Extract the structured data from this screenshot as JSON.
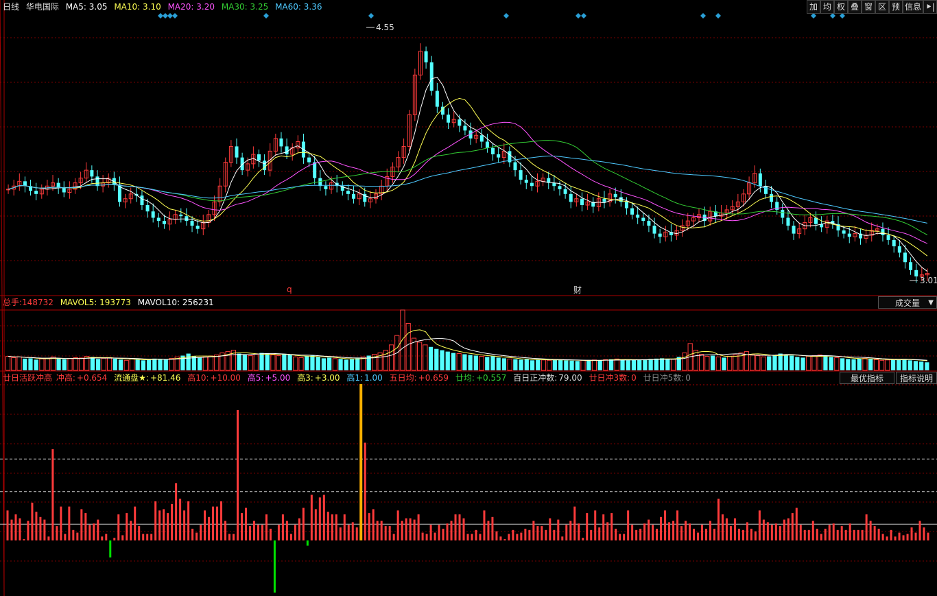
{
  "colors": {
    "up": "#ff3b3b",
    "down": "#54ffff",
    "ma5": "#ffffff",
    "ma10": "#ffff54",
    "ma20": "#ff54ff",
    "ma30": "#33cc33",
    "ma60": "#4ec9ff",
    "grid": "#7a0000",
    "marker": "#2a9fd6",
    "pos_bar": "#ff3b3b",
    "neg_bar": "#00e000",
    "highlight_bar": "#ffb000"
  },
  "header": {
    "period": "日线",
    "name": "华电国际",
    "ma5": {
      "label": "MA5:",
      "value": "3.05"
    },
    "ma10": {
      "label": "MA10:",
      "value": "3.10"
    },
    "ma20": {
      "label": "MA20:",
      "value": "3.20"
    },
    "ma30": {
      "label": "MA30:",
      "value": "3.25"
    },
    "ma60": {
      "label": "MA60:",
      "value": "3.36"
    }
  },
  "toolbar": [
    "加",
    "均",
    "权",
    "叠",
    "窗",
    "区",
    "预",
    "信息",
    "⯈|"
  ],
  "price_annotations": {
    "high": "4.55",
    "low": "3.01",
    "event_q": "q",
    "event_cai": "财"
  },
  "volume_header": {
    "total_label": "总手:",
    "total": "148732",
    "mavol5_label": "MAVOL5:",
    "mavol5": "193773",
    "mavol10_label": "MAVOL10:",
    "mavol10": "256231",
    "dropdown": "成交量"
  },
  "indicator_header": {
    "name": "廿日活跃冲高",
    "c1_label": "冲高:",
    "c1": "+0.654",
    "c2_label": "流通盘★:",
    "c2": "+81.46",
    "c3_label": "高10:",
    "c3": "+10.00",
    "c4_label": "高5:",
    "c4": "+5.00",
    "c5_label": "高3:",
    "c5": "+3.00",
    "c6_label": "高1:",
    "c6": "1.00",
    "c7_label": "五日均:",
    "c7": "+0.659",
    "c8_label": "廿均:",
    "c8": "+0.557",
    "c9_label": "百日正冲数:",
    "c9": "79.00",
    "c10_label": "廿日冲3数:",
    "c10": "0",
    "c11_label": "廿日冲5数:",
    "c11": "0",
    "btn_best": "最优指标",
    "btn_help": "指标说明"
  },
  "chart_data": [
    {
      "type": "candlestick",
      "title": "华电国际 日线",
      "ylim": [
        3.0,
        4.6
      ],
      "high_label": 4.55,
      "low_label": 3.01,
      "ma_latest": {
        "MA5": 3.05,
        "MA10": 3.1,
        "MA20": 3.2,
        "MA30": 3.25,
        "MA60": 3.36
      },
      "close": [
        3.58,
        3.6,
        3.63,
        3.6,
        3.57,
        3.55,
        3.58,
        3.6,
        3.62,
        3.59,
        3.56,
        3.58,
        3.62,
        3.65,
        3.7,
        3.66,
        3.6,
        3.62,
        3.65,
        3.61,
        3.5,
        3.52,
        3.55,
        3.54,
        3.48,
        3.44,
        3.4,
        3.38,
        3.36,
        3.39,
        3.42,
        3.41,
        3.38,
        3.35,
        3.33,
        3.37,
        3.42,
        3.5,
        3.6,
        3.75,
        3.85,
        3.78,
        3.7,
        3.74,
        3.8,
        3.76,
        3.7,
        3.82,
        3.9,
        3.85,
        3.8,
        3.84,
        3.88,
        3.78,
        3.75,
        3.65,
        3.6,
        3.58,
        3.62,
        3.6,
        3.57,
        3.55,
        3.52,
        3.55,
        3.5,
        3.52,
        3.55,
        3.6,
        3.66,
        3.72,
        3.78,
        3.85,
        4.05,
        4.3,
        4.45,
        4.38,
        4.2,
        4.1,
        4.05,
        4.0,
        4.02,
        3.98,
        3.95,
        3.9,
        3.92,
        3.88,
        3.84,
        3.8,
        3.78,
        3.82,
        3.75,
        3.7,
        3.64,
        3.62,
        3.6,
        3.63,
        3.65,
        3.62,
        3.6,
        3.58,
        3.55,
        3.5,
        3.52,
        3.48,
        3.5,
        3.47,
        3.52,
        3.5,
        3.55,
        3.53,
        3.5,
        3.46,
        3.42,
        3.4,
        3.38,
        3.35,
        3.3,
        3.28,
        3.31,
        3.29,
        3.32,
        3.35,
        3.38,
        3.4,
        3.42,
        3.38,
        3.44,
        3.41,
        3.43,
        3.45,
        3.47,
        3.5,
        3.55,
        3.62,
        3.68,
        3.6,
        3.55,
        3.5,
        3.45,
        3.4,
        3.35,
        3.3,
        3.33,
        3.37,
        3.4,
        3.36,
        3.34,
        3.38,
        3.36,
        3.32,
        3.3,
        3.28,
        3.3,
        3.27,
        3.29,
        3.32,
        3.33,
        3.29,
        3.26,
        3.22,
        3.18,
        3.12,
        3.07,
        3.03,
        3.04,
        3.05
      ]
    },
    {
      "type": "bar",
      "title": "成交量",
      "mavol5": 193773,
      "mavol10": 256231,
      "last": 148732,
      "values": [
        210,
        190,
        200,
        175,
        180,
        160,
        170,
        180,
        200,
        170,
        165,
        175,
        190,
        185,
        210,
        200,
        170,
        180,
        190,
        175,
        160,
        150,
        170,
        165,
        150,
        160,
        175,
        170,
        165,
        180,
        200,
        220,
        250,
        210,
        190,
        200,
        215,
        230,
        260,
        280,
        300,
        250,
        230,
        220,
        240,
        260,
        250,
        230,
        220,
        240,
        230,
        200,
        190,
        210,
        220,
        200,
        180,
        190,
        175,
        170,
        160,
        165,
        180,
        200,
        220,
        240,
        260,
        300,
        380,
        520,
        900,
        700,
        480,
        420,
        380,
        350,
        320,
        300,
        280,
        260,
        250,
        240,
        230,
        220,
        210,
        200,
        210,
        190,
        180,
        170,
        165,
        160,
        170,
        150,
        160,
        155,
        150,
        165,
        160,
        150,
        145,
        140,
        150,
        145,
        155,
        150,
        160,
        165,
        170,
        160,
        150,
        155,
        160,
        165,
        170,
        175,
        180,
        170,
        165,
        200,
        260,
        400,
        300,
        240,
        210,
        220,
        200,
        190,
        210,
        230,
        260,
        280,
        240,
        220,
        200,
        210,
        230,
        250,
        240,
        220,
        200,
        190,
        210,
        220,
        230,
        210,
        200,
        190,
        180,
        170,
        165,
        175,
        180,
        170,
        160,
        150,
        155,
        160,
        165,
        170,
        150,
        140,
        130,
        120
      ]
    },
    {
      "type": "bar",
      "title": "廿日活跃冲高",
      "baseline": 0,
      "reference_lines": [
        1.0,
        3.0,
        5.0
      ],
      "values": [
        2.3,
        1.6,
        2.0,
        1.7,
        0.1,
        1.5,
        2.9,
        2.2,
        1.8,
        1.6,
        0.3,
        7.0,
        1.1,
        2.6,
        0.5,
        2.6,
        0.8,
        0.6,
        2.4,
        2.1,
        1.2,
        1.3,
        1.6,
        0.3,
        0.5,
        -1.3,
        0.2,
        2.0,
        0.4,
        2.1,
        1.5,
        2.6,
        1.1,
        0.5,
        0.5,
        0.5,
        3.0,
        2.3,
        2.4,
        2.1,
        2.8,
        4.4,
        3.2,
        2.3,
        3.0,
        0.9,
        0.6,
        1.2,
        2.3,
        1.8,
        2.6,
        2.6,
        3.0,
        1.5,
        0.5,
        0.5,
        10.0,
        2.1,
        2.5,
        1.1,
        1.5,
        1.2,
        1.2,
        2.0,
        0.9,
        -4.0,
        1.2,
        2.0,
        1.5,
        0.5,
        1.2,
        1.7,
        2.5,
        -0.4,
        3.5,
        2.4,
        3.3,
        3.5,
        2.2,
        2.0,
        2.0,
        1.0,
        2.0,
        1.2,
        1.4,
        1.0,
        12.0,
        7.5,
        2.1,
        2.4,
        1.5,
        1.5,
        1.1,
        1.1,
        0.5,
        2.3,
        1.5,
        1.7,
        1.7,
        1.6,
        2.0,
        0.6,
        0.5,
        1.2,
        0.6,
        1.2,
        0.9,
        1.3,
        1.5,
        2.0,
        2.0,
        1.7,
        0.5,
        0.5,
        0.8,
        0.5,
        2.3,
        1.5,
        1.8,
        0.7,
        0.3,
        0.1,
        0.5,
        0.8,
        0.5,
        0.6,
        0.9,
        0.8,
        1.5,
        1.1,
        1.1,
        0.8,
        1.7,
        0.8,
        1.6,
        0.3,
        1.2,
        1.5,
        2.6,
        1.3,
        0.2,
        2.1,
        0.8,
        2.3,
        1.0,
        2.0,
        1.4,
        2.1,
        0.9,
        0.5,
        0.5,
        2.3,
        1.2,
        0.8,
        0.9,
        1.3,
        1.6,
        1.2,
        0.9,
        1.8,
        2.3,
        1.4,
        1.5,
        2.3,
        1.1,
        1.5,
        1.3,
        0.9,
        0.6,
        1.2,
        0.9,
        1.5,
        0.9,
        3.2,
        2.0,
        1.7,
        1.1,
        1.7,
        0.9,
        0.8,
        1.4,
        0.9,
        0.7,
        2.3,
        1.6,
        1.4,
        1.2,
        1.3,
        1.1,
        1.6,
        1.7,
        2.1,
        2.5,
        1.2,
        0.8,
        0.8,
        1.5,
        0.9,
        0.5,
        0.9,
        1.2,
        1.3,
        0.8,
        1.1,
        0.8,
        1.3,
        0.8,
        0.8,
        0.8,
        2.0,
        1.5,
        1.1,
        0.9,
        0.5,
        0.3,
        0.8,
        0.3,
        0.6,
        0.4,
        0.5,
        1.0,
        0.6,
        1.5,
        1.0,
        0.6
      ]
    }
  ]
}
